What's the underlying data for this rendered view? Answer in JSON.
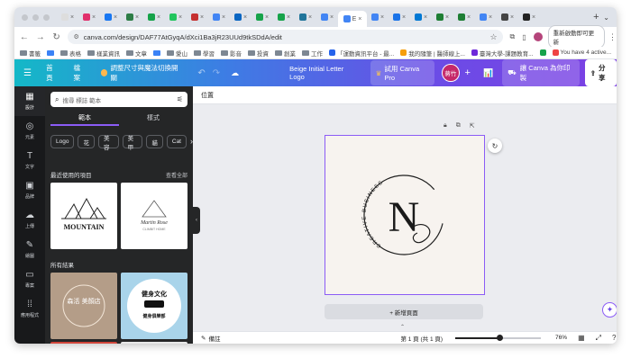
{
  "browser": {
    "tabs": [
      {
        "color": "#dddddd"
      },
      {
        "color": "#e1306c"
      },
      {
        "color": "#1877f2"
      },
      {
        "color": "#2d7d46"
      },
      {
        "color": "#16a34a"
      },
      {
        "color": "#22c55e"
      },
      {
        "color": "#c53030"
      },
      {
        "color": "#4285f4"
      },
      {
        "color": "#0a66c2"
      },
      {
        "color": "#16a34a"
      },
      {
        "color": "#16a34a"
      },
      {
        "color": "#21759b"
      },
      {
        "color": "#4285f4"
      },
      {
        "color": "#4285f4",
        "label": "E"
      },
      {
        "color": "#4285f4"
      },
      {
        "color": "#1a73e8"
      },
      {
        "color": "#0078d4"
      },
      {
        "color": "#1e7e34"
      },
      {
        "color": "#1e7e34"
      },
      {
        "color": "#4285f4"
      },
      {
        "color": "#444"
      },
      {
        "color": "#222"
      }
    ],
    "url": "canva.com/design/DAF77AtGyqA/dXci1Ba3jR23UUd9tkSDdA/edit",
    "update_button": "重新啟動即可更新",
    "bookmarks": [
      "書籤",
      "",
      "表格",
      "樣業資訊",
      "文章",
      "",
      "愛山",
      "學習",
      "影音",
      "投資",
      "創業",
      "工作",
      "「運動資訊平台 - 最...",
      "我的隨筆 | 醫師線上...",
      "臺灣大學-課題教育...",
      "",
      "You have 4 active..."
    ]
  },
  "header": {
    "home": "首頁",
    "file": "檔案",
    "resize": "調整尺寸與魔法切換開關",
    "doc_title": "Beige Initial Letter Logo",
    "try_pro": "試用 Canva Pro",
    "avatar_text": "蔣竹",
    "print": "讓 Canva 為你印製",
    "share": "分享"
  },
  "rail": [
    {
      "icon": "▦",
      "label": "設計"
    },
    {
      "icon": "◎",
      "label": "元素"
    },
    {
      "icon": "T",
      "label": "文字"
    },
    {
      "icon": "▣",
      "label": "品牌"
    },
    {
      "icon": "☁",
      "label": "上傳"
    },
    {
      "icon": "✎",
      "label": "繪圖"
    },
    {
      "icon": "▭",
      "label": "專案"
    },
    {
      "icon": "⁞⁞",
      "label": "應用程式"
    }
  ],
  "panel": {
    "search_placeholder": "搜尋 標誌 範本",
    "tab_templates": "範本",
    "tab_styles": "樣式",
    "chips": [
      "Logo",
      "花",
      "美容",
      "美甲",
      "貓",
      "Cat"
    ],
    "recent_title": "最近使用的項目",
    "see_all": "查看全部",
    "all_results": "所有結果",
    "thumb1_text": "MOUNTAIN",
    "thumb2_text": "Martin Rose",
    "thumb2_sub": "CLIMBIT HOME",
    "thumb3_text": "森活\n美顏店",
    "thumb4_title": "健身文化",
    "thumb4_sub": "健身俱樂部"
  },
  "canvas": {
    "position_label": "位置",
    "logo_letter": "N",
    "logo_arc_text": "CREATIVE BUSINESS",
    "add_page": "+ 新增頁面"
  },
  "footer": {
    "notes": "備註",
    "pages": "第 1 頁 (共 1 頁)",
    "zoom_value": "76%",
    "zoom_fraction": 0.52
  },
  "colors": {
    "accent": "#8b5cf6",
    "canvas_bg": "#f7f3ef"
  }
}
